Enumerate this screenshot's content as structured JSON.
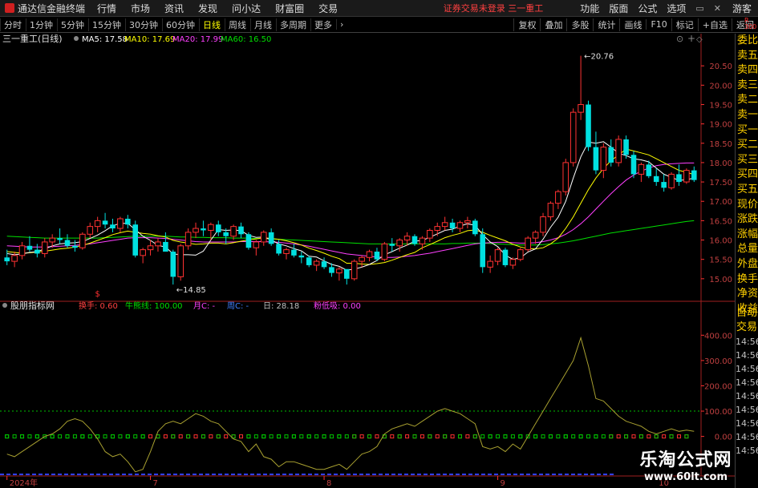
{
  "app": {
    "title": "通达信金融终端",
    "menu": [
      "行情",
      "市场",
      "资讯",
      "发现",
      "问小达",
      "财富圈",
      "交易"
    ],
    "status": "证券交易未登录  三一重工",
    "right_menu": [
      "功能",
      "版面",
      "公式",
      "选项"
    ],
    "guest": "游客"
  },
  "toolbar": {
    "periods": [
      "分时",
      "1分钟",
      "5分钟",
      "15分钟",
      "30分钟",
      "60分钟",
      "日线",
      "周线",
      "月线",
      "多周期",
      "更多"
    ],
    "active_period": "日线",
    "right_tools": [
      "复权",
      "叠加",
      "多股",
      "统计",
      "画线",
      "F10",
      "标记",
      "+自选",
      "返回"
    ],
    "badge": "R 300"
  },
  "colors": {
    "up": "#ff3232",
    "down": "#00e0e0",
    "ma5": "#ffffff",
    "ma10": "#ffff00",
    "ma20": "#ff40ff",
    "ma60": "#00e000",
    "indicator": "#a8a030",
    "axis": "#ff3030"
  },
  "sidebar": {
    "items": [
      "委比",
      "卖五",
      "卖四",
      "卖三",
      "卖二",
      "卖一",
      "买一",
      "买二",
      "买三",
      "买四",
      "买五",
      "现价",
      "涨跌",
      "涨幅",
      "总量",
      "外盘",
      "换手",
      "净资",
      "收益"
    ],
    "lower_items": [
      "自动",
      "交易"
    ],
    "times": [
      "14:56",
      "14:56",
      "14:56",
      "14:56",
      "14:56",
      "14:56",
      "14:56",
      "14:56",
      "14:56"
    ]
  },
  "watermark": {
    "line1": "乐淘公式网",
    "line2": "www.60lt.com"
  },
  "chart_data": {
    "type": "candlestick",
    "main_legend": {
      "stock": "三一重工(日线)",
      "ma5": "MA5: 17.58",
      "ma10": "MA10: 17.69",
      "ma20": "MA20: 17.99",
      "ma60": "MA60: 16.50"
    },
    "price_axis": {
      "min": 14.5,
      "max": 21.0,
      "ticks": [
        15.0,
        15.5,
        16.0,
        16.5,
        17.0,
        17.5,
        18.0,
        18.5,
        19.0,
        19.5,
        20.0,
        20.5
      ]
    },
    "high_label": "20.76",
    "low_label": "14.85",
    "signal_mark": "$",
    "candles": [
      [
        15.55,
        15.75,
        15.35,
        15.45
      ],
      [
        15.45,
        15.7,
        15.3,
        15.6
      ],
      [
        15.6,
        15.95,
        15.5,
        15.85
      ],
      [
        15.85,
        16.1,
        15.7,
        15.75
      ],
      [
        15.75,
        15.9,
        15.55,
        15.65
      ],
      [
        15.65,
        16.05,
        15.55,
        15.95
      ],
      [
        15.95,
        16.15,
        15.8,
        16.05
      ],
      [
        16.05,
        16.3,
        15.9,
        16.0
      ],
      [
        16.0,
        16.15,
        15.8,
        15.85
      ],
      [
        15.85,
        16.0,
        15.7,
        15.8
      ],
      [
        15.8,
        16.2,
        15.75,
        16.15
      ],
      [
        16.15,
        16.45,
        16.05,
        16.35
      ],
      [
        16.35,
        16.6,
        16.2,
        16.5
      ],
      [
        16.5,
        16.7,
        16.3,
        16.4
      ],
      [
        16.4,
        16.55,
        16.2,
        16.3
      ],
      [
        16.3,
        16.6,
        16.2,
        16.55
      ],
      [
        16.55,
        16.65,
        16.3,
        16.4
      ],
      [
        16.4,
        16.5,
        15.55,
        15.6
      ],
      [
        15.6,
        15.8,
        15.4,
        15.75
      ],
      [
        15.75,
        16.0,
        15.6,
        15.85
      ],
      [
        15.85,
        16.05,
        15.7,
        15.95
      ],
      [
        15.95,
        16.2,
        15.8,
        15.7
      ],
      [
        15.7,
        15.75,
        14.85,
        15.05
      ],
      [
        15.05,
        15.9,
        14.95,
        15.85
      ],
      [
        15.85,
        16.3,
        15.75,
        16.2
      ],
      [
        16.2,
        16.45,
        16.05,
        16.3
      ],
      [
        16.3,
        16.5,
        16.1,
        16.25
      ],
      [
        16.25,
        16.45,
        16.0,
        16.4
      ],
      [
        16.4,
        16.5,
        16.1,
        16.2
      ],
      [
        16.2,
        16.3,
        15.9,
        16.1
      ],
      [
        16.1,
        16.4,
        16.0,
        16.35
      ],
      [
        16.35,
        16.45,
        16.05,
        16.15
      ],
      [
        16.15,
        16.2,
        15.75,
        15.8
      ],
      [
        15.8,
        16.0,
        15.6,
        15.95
      ],
      [
        15.95,
        16.25,
        15.85,
        16.2
      ],
      [
        16.2,
        16.3,
        15.85,
        15.9
      ],
      [
        15.9,
        16.0,
        15.6,
        15.65
      ],
      [
        15.65,
        15.8,
        15.5,
        15.75
      ],
      [
        15.75,
        15.9,
        15.55,
        15.6
      ],
      [
        15.6,
        15.7,
        15.4,
        15.55
      ],
      [
        15.55,
        15.6,
        15.3,
        15.35
      ],
      [
        15.35,
        15.5,
        15.2,
        15.45
      ],
      [
        15.45,
        15.55,
        15.25,
        15.3
      ],
      [
        15.3,
        15.4,
        15.05,
        15.15
      ],
      [
        15.15,
        15.3,
        14.95,
        15.25
      ],
      [
        15.25,
        15.1,
        14.85,
        15.0
      ],
      [
        15.0,
        15.5,
        14.95,
        15.45
      ],
      [
        15.45,
        15.6,
        15.3,
        15.55
      ],
      [
        15.55,
        15.75,
        15.45,
        15.7
      ],
      [
        15.7,
        15.8,
        15.45,
        15.5
      ],
      [
        15.5,
        15.95,
        15.45,
        15.9
      ],
      [
        15.9,
        16.05,
        15.7,
        15.85
      ],
      [
        15.85,
        16.05,
        15.7,
        16.0
      ],
      [
        16.0,
        16.2,
        15.85,
        16.1
      ],
      [
        16.1,
        16.15,
        15.85,
        15.9
      ],
      [
        15.9,
        16.1,
        15.75,
        16.05
      ],
      [
        16.05,
        16.3,
        15.95,
        16.25
      ],
      [
        16.25,
        16.45,
        16.1,
        16.35
      ],
      [
        16.35,
        16.6,
        16.25,
        16.45
      ],
      [
        16.45,
        16.55,
        16.2,
        16.3
      ],
      [
        16.3,
        16.5,
        16.2,
        16.45
      ],
      [
        16.45,
        16.6,
        16.3,
        16.5
      ],
      [
        16.5,
        16.55,
        16.1,
        16.15
      ],
      [
        16.15,
        16.3,
        15.15,
        15.3
      ],
      [
        15.3,
        15.6,
        15.15,
        15.45
      ],
      [
        15.45,
        15.8,
        15.35,
        15.75
      ],
      [
        15.75,
        15.8,
        15.3,
        15.35
      ],
      [
        15.35,
        15.55,
        15.25,
        15.5
      ],
      [
        15.5,
        15.8,
        15.45,
        15.75
      ],
      [
        15.75,
        16.1,
        15.7,
        16.05
      ],
      [
        16.05,
        16.25,
        15.9,
        16.2
      ],
      [
        16.2,
        16.7,
        16.1,
        16.6
      ],
      [
        16.6,
        17.0,
        16.5,
        16.95
      ],
      [
        16.95,
        17.3,
        16.8,
        17.25
      ],
      [
        17.25,
        18.1,
        17.15,
        18.0
      ],
      [
        18.0,
        19.4,
        17.9,
        19.3
      ],
      [
        19.3,
        20.76,
        19.1,
        19.5
      ],
      [
        19.5,
        19.6,
        18.3,
        18.4
      ],
      [
        18.4,
        18.8,
        17.7,
        17.8
      ],
      [
        17.8,
        18.5,
        17.6,
        18.4
      ],
      [
        18.4,
        18.6,
        17.9,
        18.0
      ],
      [
        18.0,
        18.7,
        17.9,
        18.6
      ],
      [
        18.6,
        18.7,
        18.1,
        18.2
      ],
      [
        18.2,
        18.3,
        17.6,
        17.7
      ],
      [
        17.7,
        18.0,
        17.5,
        17.95
      ],
      [
        17.95,
        18.05,
        17.6,
        17.65
      ],
      [
        17.65,
        17.85,
        17.4,
        17.5
      ],
      [
        17.5,
        17.7,
        17.25,
        17.35
      ],
      [
        17.35,
        17.75,
        17.3,
        17.7
      ],
      [
        17.7,
        17.95,
        17.4,
        17.5
      ],
      [
        17.5,
        17.85,
        17.45,
        17.8
      ],
      [
        17.8,
        17.9,
        17.5,
        17.55
      ]
    ],
    "ma5": [
      15.65,
      15.62,
      15.64,
      15.68,
      15.7,
      15.77,
      15.85,
      15.9,
      15.92,
      15.93,
      15.96,
      16.04,
      16.13,
      16.24,
      16.37,
      16.43,
      16.43,
      16.27,
      16.1,
      15.99,
      15.86,
      15.82,
      15.64,
      15.62,
      15.62,
      15.61,
      15.71,
      16.0,
      16.27,
      16.25,
      16.26,
      16.24,
      16.12,
      16.07,
      16.08,
      16.0,
      15.9,
      15.85,
      15.78,
      15.72,
      15.58,
      15.56,
      15.46,
      15.37,
      15.32,
      15.22,
      15.25,
      15.3,
      15.37,
      15.47,
      15.62,
      15.7,
      15.79,
      15.87,
      15.97,
      15.99,
      16.07,
      16.16,
      16.25,
      16.28,
      16.36,
      16.42,
      16.38,
      16.14,
      15.95,
      15.83,
      15.61,
      15.5,
      15.54,
      15.69,
      15.77,
      16.02,
      16.33,
      16.59,
      17.0,
      17.6,
      18.15,
      18.53,
      18.5,
      18.54,
      18.4,
      18.24,
      18.18,
      18.1,
      18.07,
      18.02,
      17.86,
      17.7,
      17.62,
      17.54,
      17.56,
      17.6
    ],
    "ma10": [
      15.7,
      15.68,
      15.66,
      15.67,
      15.69,
      15.71,
      15.74,
      15.77,
      15.79,
      15.82,
      15.86,
      15.92,
      15.99,
      16.06,
      16.14,
      16.19,
      16.23,
      16.2,
      16.17,
      16.15,
      16.11,
      16.08,
      15.99,
      15.95,
      15.92,
      15.89,
      15.9,
      15.92,
      15.92,
      15.9,
      15.93,
      15.97,
      16.0,
      16.03,
      16.06,
      16.04,
      16.02,
      15.98,
      15.93,
      15.87,
      15.79,
      15.73,
      15.66,
      15.58,
      15.52,
      15.4,
      15.4,
      15.38,
      15.37,
      15.39,
      15.42,
      15.48,
      15.55,
      15.62,
      15.68,
      15.8,
      15.88,
      15.97,
      16.06,
      16.12,
      16.17,
      16.24,
      16.26,
      16.2,
      16.12,
      16.05,
      15.98,
      15.89,
      15.82,
      15.78,
      15.77,
      15.8,
      15.9,
      16.05,
      16.3,
      16.6,
      16.95,
      17.3,
      17.6,
      17.85,
      18.05,
      18.2,
      18.35,
      18.3,
      18.25,
      18.2,
      18.1,
      18.0,
      17.9,
      17.8,
      17.75,
      17.69
    ],
    "ma20": [
      15.85,
      15.84,
      15.83,
      15.82,
      15.82,
      15.82,
      15.83,
      15.84,
      15.85,
      15.86,
      15.88,
      15.9,
      15.93,
      15.96,
      15.99,
      16.02,
      16.05,
      16.06,
      16.06,
      16.06,
      16.05,
      16.04,
      16.02,
      16.0,
      15.98,
      15.96,
      15.95,
      15.95,
      15.95,
      15.95,
      15.95,
      15.96,
      15.96,
      15.96,
      15.96,
      15.95,
      15.94,
      15.92,
      15.9,
      15.87,
      15.84,
      15.8,
      15.76,
      15.72,
      15.68,
      15.64,
      15.62,
      15.6,
      15.58,
      15.56,
      15.55,
      15.55,
      15.56,
      15.58,
      15.6,
      15.63,
      15.66,
      15.7,
      15.74,
      15.78,
      15.82,
      15.86,
      15.9,
      15.92,
      15.93,
      15.94,
      15.94,
      15.93,
      15.92,
      15.92,
      15.93,
      15.96,
      16.0,
      16.06,
      16.15,
      16.27,
      16.42,
      16.6,
      16.8,
      17.0,
      17.2,
      17.38,
      17.55,
      17.68,
      17.78,
      17.86,
      17.92,
      17.95,
      17.97,
      17.98,
      17.99,
      17.99
    ],
    "ma60": [
      16.1,
      16.09,
      16.08,
      16.07,
      16.06,
      16.05,
      16.05,
      16.05,
      16.05,
      16.05,
      16.05,
      16.05,
      16.05,
      16.06,
      16.07,
      16.08,
      16.09,
      16.1,
      16.1,
      16.1,
      16.1,
      16.1,
      16.09,
      16.08,
      16.08,
      16.07,
      16.07,
      16.06,
      16.06,
      16.06,
      16.05,
      16.05,
      16.05,
      16.04,
      16.04,
      16.03,
      16.02,
      16.01,
      16.0,
      15.99,
      15.98,
      15.97,
      15.96,
      15.95,
      15.94,
      15.93,
      15.92,
      15.91,
      15.9,
      15.9,
      15.9,
      15.9,
      15.9,
      15.9,
      15.9,
      15.9,
      15.9,
      15.9,
      15.9,
      15.91,
      15.91,
      15.92,
      15.92,
      15.92,
      15.91,
      15.9,
      15.89,
      15.88,
      15.87,
      15.87,
      15.87,
      15.88,
      15.9,
      15.92,
      15.95,
      15.98,
      16.02,
      16.06,
      16.1,
      16.14,
      16.18,
      16.21,
      16.24,
      16.27,
      16.3,
      16.33,
      16.36,
      16.39,
      16.42,
      16.45,
      16.48,
      16.5
    ],
    "indicator": {
      "name": "股朋指标网",
      "legend": [
        "换手: 0.60",
        "牛熊线: 100.00",
        "月C: -",
        "周C: -",
        "日: 28.18",
        "粉低吸: 0.00"
      ],
      "legend_colors": [
        "#ff4040",
        "#00e000",
        "#ff40ff",
        "#4080ff",
        "#c0c0c0",
        "#ff40ff"
      ],
      "axis_ticks": [
        0,
        100,
        200,
        300,
        400
      ],
      "axis_range": [
        -150,
        420
      ],
      "bull_bear_line": 100,
      "zero_line": 0,
      "blue_line": -150,
      "values": [
        -70,
        -80,
        -60,
        -40,
        -20,
        0,
        10,
        30,
        60,
        70,
        60,
        30,
        -10,
        -60,
        -80,
        -70,
        -100,
        -140,
        -130,
        -60,
        20,
        50,
        60,
        50,
        70,
        90,
        80,
        60,
        50,
        20,
        -10,
        -20,
        -60,
        -30,
        -80,
        -90,
        -120,
        -100,
        -100,
        -110,
        -120,
        -130,
        -130,
        -120,
        -110,
        -130,
        -100,
        -70,
        -60,
        -40,
        10,
        30,
        40,
        50,
        40,
        60,
        80,
        100,
        110,
        100,
        90,
        70,
        50,
        -40,
        -50,
        -40,
        -60,
        -30,
        -50,
        0,
        50,
        100,
        150,
        200,
        250,
        300,
        390,
        280,
        150,
        140,
        110,
        80,
        60,
        50,
        40,
        20,
        10,
        20,
        30,
        20,
        25,
        20
      ],
      "low_markers_red": [
        [
          19,
          31
        ],
        [
          46,
          62
        ],
        [
          80,
          90
        ]
      ],
      "low_markers_green": [
        [
          0,
          18
        ],
        [
          32,
          45
        ],
        [
          63,
          79
        ]
      ]
    },
    "x_labels": [
      {
        "i": 0,
        "label": "2024年"
      },
      {
        "i": 19,
        "label": "7"
      },
      {
        "i": 42,
        "label": "8"
      },
      {
        "i": 65,
        "label": "9"
      },
      {
        "i": 86,
        "label": "10"
      }
    ]
  }
}
